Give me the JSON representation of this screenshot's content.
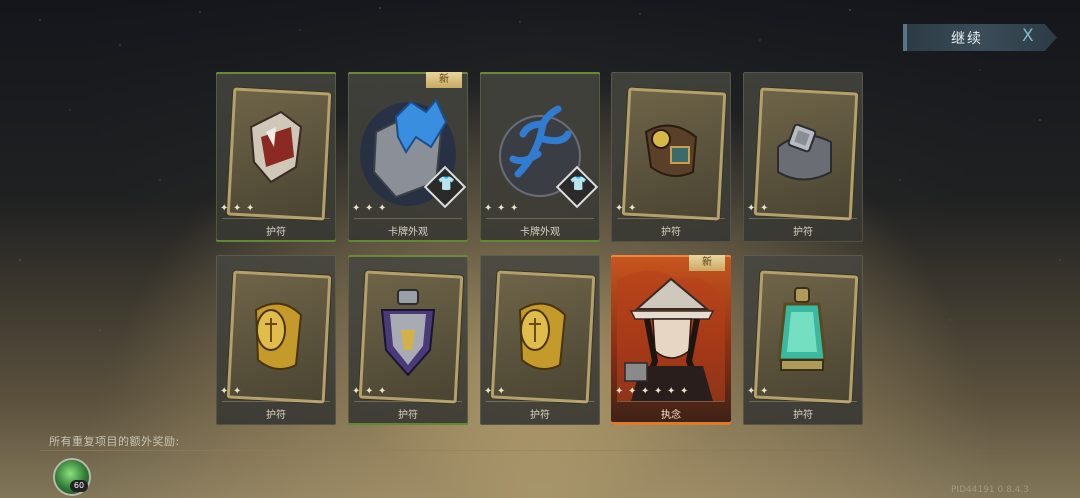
{
  "header": {
    "continue_label": "继续",
    "close_glyph": "X"
  },
  "rewards": {
    "row1": [
      {
        "label": "护符",
        "stars": 3,
        "new": false,
        "skin": false,
        "border": "green",
        "icon": "broken-helmet-icon"
      },
      {
        "label": "卡牌外观",
        "stars": 3,
        "new": true,
        "skin": true,
        "border": "green",
        "icon": "blue-crystal-rock-icon"
      },
      {
        "label": "卡牌外观",
        "stars": 3,
        "new": false,
        "skin": true,
        "border": "green",
        "icon": "blue-antler-icon"
      },
      {
        "label": "护符",
        "stars": 2,
        "new": false,
        "skin": false,
        "border": "none",
        "icon": "goggles-amulet-icon"
      },
      {
        "label": "护符",
        "stars": 2,
        "new": false,
        "skin": false,
        "border": "none",
        "icon": "steel-ring-icon"
      }
    ],
    "row2": [
      {
        "label": "护符",
        "stars": 2,
        "new": false,
        "skin": false,
        "border": "none",
        "icon": "gold-bracer-icon"
      },
      {
        "label": "护符",
        "stars": 3,
        "new": false,
        "skin": false,
        "border": "green",
        "icon": "shield-flask-icon"
      },
      {
        "label": "护符",
        "stars": 2,
        "new": false,
        "skin": false,
        "border": "none",
        "icon": "gold-bracer-icon"
      },
      {
        "label": "执念",
        "stars": 6,
        "new": true,
        "skin": false,
        "border": "orange",
        "icon": "hatted-heroine-portrait"
      },
      {
        "label": "护符",
        "stars": 2,
        "new": false,
        "skin": false,
        "border": "none",
        "icon": "green-lantern-icon"
      }
    ],
    "new_badge": "新"
  },
  "bonus": {
    "label": "所有重复项目的额外奖励:",
    "item_count": "60",
    "item_icon": "green-gem-icon"
  },
  "footer": {
    "pid": "PID44191  0.8.4.3"
  },
  "colors": {
    "accent_green": "#6a8a3a",
    "accent_orange": "#e07a2a",
    "button_bg": "#3b4c58"
  }
}
